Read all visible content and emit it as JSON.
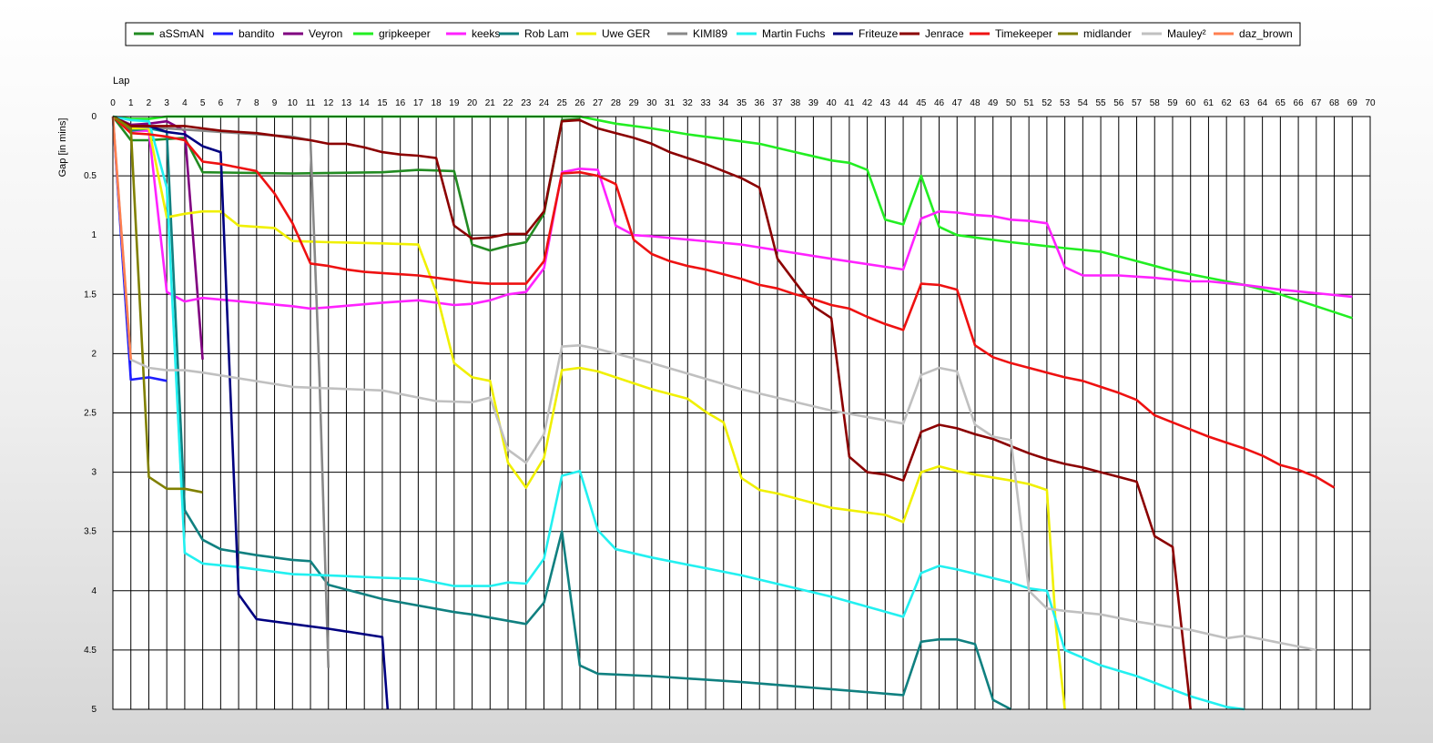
{
  "chart_data": {
    "type": "line",
    "xlabel": "Lap",
    "ylabel": "Gap [in mins]",
    "xlim": [
      0,
      70
    ],
    "ylim": [
      0,
      5
    ],
    "y_inverted": true,
    "grid": true,
    "legend_position": "top",
    "xticks": [
      0,
      1,
      2,
      3,
      4,
      5,
      6,
      7,
      8,
      9,
      10,
      11,
      12,
      13,
      14,
      15,
      16,
      17,
      18,
      19,
      20,
      21,
      22,
      23,
      24,
      25,
      26,
      27,
      28,
      29,
      30,
      31,
      32,
      33,
      34,
      35,
      36,
      37,
      38,
      39,
      40,
      41,
      42,
      43,
      44,
      45,
      46,
      47,
      48,
      49,
      50,
      51,
      52,
      53,
      54,
      55,
      56,
      57,
      58,
      59,
      60,
      61,
      62,
      63,
      64,
      65,
      66,
      67,
      68,
      69,
      70
    ],
    "yticks": [
      "0",
      "0.5",
      "1",
      "1.5",
      "2",
      "2.5",
      "3",
      "3.5",
      "4",
      "4.5",
      "5"
    ],
    "series": [
      {
        "name": "aSSmAN",
        "color": "#228b22",
        "x": [
          0,
          1,
          2,
          3,
          4,
          5,
          10,
          15,
          17,
          19,
          20,
          21,
          22,
          23,
          24,
          25,
          26
        ],
        "y": [
          0,
          0.2,
          0.2,
          0.19,
          0.18,
          0.47,
          0.48,
          0.47,
          0.45,
          0.46,
          1.08,
          1.13,
          1.09,
          1.06,
          0.82,
          0.03,
          0.02
        ]
      },
      {
        "name": "bandito",
        "color": "#1e1eff",
        "x": [
          0,
          1,
          2,
          3
        ],
        "y": [
          0,
          2.22,
          2.2,
          2.23
        ]
      },
      {
        "name": "Veyron",
        "color": "#800080",
        "x": [
          0,
          1,
          2,
          3,
          4,
          5
        ],
        "y": [
          0,
          0.07,
          0.06,
          0.04,
          0.12,
          2.05
        ]
      },
      {
        "name": "gripkeeper",
        "color": "#22ee22",
        "x": [
          0,
          1,
          2,
          3,
          10,
          20,
          26,
          28,
          30,
          32,
          34,
          36,
          38,
          40,
          41,
          42,
          43,
          44,
          45,
          46,
          47,
          48,
          50,
          53,
          55,
          57,
          59,
          61,
          63,
          65,
          67,
          69
        ],
        "y": [
          0,
          0.02,
          0.02,
          0,
          0,
          0,
          0,
          0.06,
          0.1,
          0.15,
          0.19,
          0.23,
          0.3,
          0.37,
          0.39,
          0.45,
          0.87,
          0.91,
          0.5,
          0.93,
          1.0,
          1.02,
          1.06,
          1.11,
          1.14,
          1.22,
          1.3,
          1.36,
          1.42,
          1.5,
          1.6,
          1.7
        ]
      },
      {
        "name": "keeks",
        "color": "#ff22ff",
        "x": [
          0,
          1,
          2,
          3,
          4,
          5,
          10,
          11,
          12,
          15,
          17,
          19,
          20,
          21,
          22,
          23,
          24,
          25,
          26,
          27,
          28,
          29,
          30,
          35,
          40,
          44,
          45,
          46,
          47,
          48,
          49,
          50,
          51,
          52,
          53,
          54,
          55,
          56,
          57,
          58,
          60,
          61,
          63,
          65,
          67,
          69
        ],
        "y": [
          0,
          0.12,
          0.12,
          1.48,
          1.56,
          1.53,
          1.6,
          1.62,
          1.61,
          1.57,
          1.55,
          1.59,
          1.58,
          1.55,
          1.5,
          1.48,
          1.28,
          0.47,
          0.44,
          0.45,
          0.92,
          1.0,
          1.01,
          1.08,
          1.2,
          1.29,
          0.86,
          0.8,
          0.81,
          0.83,
          0.84,
          0.87,
          0.88,
          0.9,
          1.27,
          1.34,
          1.34,
          1.34,
          1.35,
          1.36,
          1.39,
          1.39,
          1.42,
          1.46,
          1.49,
          1.52
        ]
      },
      {
        "name": "Rob Lam",
        "color": "#108080",
        "x": [
          0,
          1,
          2,
          3,
          4,
          5,
          6,
          8,
          10,
          11,
          12,
          15,
          19,
          20,
          23,
          24,
          25,
          26,
          27,
          30,
          35,
          40,
          44,
          45,
          46,
          47,
          48,
          49,
          50
        ],
        "y": [
          0,
          0.12,
          0.1,
          0.13,
          3.32,
          3.57,
          3.65,
          3.7,
          3.74,
          3.75,
          3.95,
          4.07,
          4.18,
          4.2,
          4.28,
          4.1,
          3.5,
          4.63,
          4.7,
          4.72,
          4.77,
          4.83,
          4.88,
          4.43,
          4.41,
          4.41,
          4.45,
          4.92,
          5.0
        ]
      },
      {
        "name": "Uwe GER",
        "color": "#f0f000",
        "x": [
          0,
          1,
          2,
          3,
          4,
          5,
          6,
          7,
          9,
          10,
          12,
          15,
          17,
          18,
          19,
          20,
          21,
          22,
          23,
          24,
          25,
          26,
          27,
          30,
          32,
          33,
          34,
          35,
          36,
          37,
          40,
          43,
          44,
          45,
          46,
          47,
          48,
          50,
          51,
          52,
          52.5,
          53
        ],
        "y": [
          0,
          0.1,
          0.1,
          0.85,
          0.82,
          0.8,
          0.8,
          0.92,
          0.94,
          1.05,
          1.06,
          1.07,
          1.08,
          1.48,
          2.08,
          2.2,
          2.23,
          2.92,
          3.13,
          2.88,
          2.14,
          2.12,
          2.15,
          2.3,
          2.38,
          2.49,
          2.58,
          3.05,
          3.15,
          3.18,
          3.3,
          3.36,
          3.42,
          3.0,
          2.95,
          2.99,
          3.02,
          3.07,
          3.1,
          3.15,
          4.3,
          5.0
        ]
      },
      {
        "name": "KIMI89",
        "color": "#888888",
        "x": [
          0,
          1,
          2,
          3,
          4,
          5,
          6,
          8,
          10,
          11,
          11.5,
          12
        ],
        "y": [
          0,
          0.08,
          0.09,
          0.1,
          0.11,
          0.12,
          0.13,
          0.15,
          0.17,
          0.2,
          2.2,
          4.65
        ]
      },
      {
        "name": "Martin Fuchs",
        "color": "#22f0f0",
        "x": [
          0,
          1,
          2,
          3,
          4,
          5,
          7,
          10,
          12,
          15,
          17,
          19,
          21,
          22,
          23,
          24,
          25,
          26,
          27,
          28,
          30,
          35,
          40,
          44,
          45,
          46,
          47,
          50,
          51,
          52,
          53,
          55,
          57,
          60,
          62,
          63
        ],
        "y": [
          0,
          0.03,
          0.04,
          0.6,
          3.68,
          3.77,
          3.8,
          3.86,
          3.87,
          3.89,
          3.9,
          3.96,
          3.96,
          3.93,
          3.94,
          3.73,
          3.03,
          2.99,
          3.49,
          3.65,
          3.72,
          3.87,
          4.05,
          4.22,
          3.85,
          3.79,
          3.82,
          3.93,
          3.98,
          4.0,
          4.5,
          4.63,
          4.72,
          4.89,
          4.98,
          5.0
        ]
      },
      {
        "name": "Friteuze",
        "color": "#000080",
        "x": [
          0,
          1,
          2,
          3,
          4,
          5,
          6,
          7,
          8,
          10,
          12,
          15,
          15.3
        ],
        "y": [
          0,
          0.08,
          0.08,
          0.13,
          0.15,
          0.25,
          0.3,
          4.03,
          4.24,
          4.28,
          4.32,
          4.39,
          5.0
        ]
      },
      {
        "name": "Jenrace",
        "color": "#8b0000",
        "x": [
          0,
          1,
          2,
          3,
          4,
          5,
          6,
          8,
          10,
          11,
          12,
          13,
          14,
          15,
          16,
          17,
          18,
          19,
          20,
          21,
          22,
          23,
          24,
          25,
          26,
          27,
          28,
          29,
          30,
          31,
          32,
          33,
          34,
          35,
          36,
          37,
          38,
          39,
          40,
          41,
          42,
          43,
          44,
          45,
          46,
          47,
          48,
          49,
          50,
          51,
          52,
          53,
          54,
          55,
          56,
          57,
          58,
          59,
          60
        ],
        "y": [
          0,
          0.08,
          0.08,
          0.08,
          0.08,
          0.1,
          0.12,
          0.14,
          0.18,
          0.2,
          0.23,
          0.23,
          0.26,
          0.3,
          0.32,
          0.33,
          0.35,
          0.92,
          1.03,
          1.02,
          0.99,
          0.99,
          0.8,
          0.04,
          0.03,
          0.1,
          0.14,
          0.18,
          0.23,
          0.3,
          0.35,
          0.4,
          0.46,
          0.52,
          0.6,
          1.2,
          1.4,
          1.6,
          1.7,
          2.87,
          3.0,
          3.02,
          3.07,
          2.66,
          2.6,
          2.63,
          2.68,
          2.72,
          2.78,
          2.84,
          2.89,
          2.93,
          2.96,
          3.0,
          3.04,
          3.08,
          3.54,
          3.63,
          5.0
        ]
      },
      {
        "name": "Timekeeper",
        "color": "#ee1111",
        "x": [
          0,
          1,
          2,
          3,
          4,
          5,
          6,
          7,
          8,
          9,
          10,
          11,
          12,
          13,
          14,
          15,
          16,
          17,
          18,
          19,
          20,
          21,
          22,
          23,
          24,
          25,
          26,
          27,
          28,
          29,
          30,
          31,
          32,
          33,
          34,
          35,
          36,
          37,
          38,
          39,
          40,
          41,
          42,
          43,
          44,
          45,
          46,
          47,
          48,
          49,
          50,
          51,
          52,
          53,
          54,
          55,
          56,
          57,
          58,
          59,
          60,
          61,
          62,
          63,
          64,
          65,
          66,
          67,
          68
        ],
        "y": [
          0,
          0.14,
          0.15,
          0.17,
          0.2,
          0.38,
          0.4,
          0.43,
          0.46,
          0.65,
          0.9,
          1.24,
          1.26,
          1.29,
          1.31,
          1.32,
          1.33,
          1.34,
          1.36,
          1.38,
          1.4,
          1.41,
          1.41,
          1.41,
          1.22,
          0.48,
          0.47,
          0.5,
          0.57,
          1.04,
          1.16,
          1.22,
          1.26,
          1.29,
          1.33,
          1.37,
          1.42,
          1.45,
          1.5,
          1.54,
          1.59,
          1.62,
          1.69,
          1.75,
          1.8,
          1.41,
          1.42,
          1.46,
          1.93,
          2.03,
          2.08,
          2.12,
          2.16,
          2.2,
          2.23,
          2.28,
          2.33,
          2.39,
          2.52,
          2.58,
          2.64,
          2.7,
          2.75,
          2.8,
          2.86,
          2.94,
          2.98,
          3.04,
          3.13
        ]
      },
      {
        "name": "midlander",
        "color": "#808000",
        "x": [
          0,
          1,
          2,
          3,
          4,
          5
        ],
        "y": [
          0,
          0.1,
          3.04,
          3.14,
          3.14,
          3.17
        ]
      },
      {
        "name": "Mauley²",
        "color": "#c0c0c0",
        "x": [
          0,
          1,
          2,
          3,
          4,
          5,
          10,
          15,
          18,
          20,
          21,
          22,
          23,
          24,
          25,
          26,
          27,
          30,
          35,
          40,
          44,
          45,
          46,
          47,
          48,
          49,
          50,
          51,
          52,
          53,
          55,
          57,
          60,
          62,
          63,
          65,
          67
        ],
        "y": [
          0,
          2.05,
          2.12,
          2.14,
          2.14,
          2.16,
          2.28,
          2.31,
          2.4,
          2.41,
          2.37,
          2.81,
          2.92,
          2.68,
          1.94,
          1.93,
          1.96,
          2.08,
          2.3,
          2.48,
          2.59,
          2.18,
          2.12,
          2.15,
          2.6,
          2.7,
          2.73,
          4.0,
          4.15,
          4.17,
          4.2,
          4.26,
          4.33,
          4.4,
          4.38,
          4.44,
          4.5
        ]
      },
      {
        "name": "daz_brown",
        "color": "#ff7f50",
        "x": [
          0,
          1
        ],
        "y": [
          0,
          2.05
        ]
      }
    ]
  }
}
